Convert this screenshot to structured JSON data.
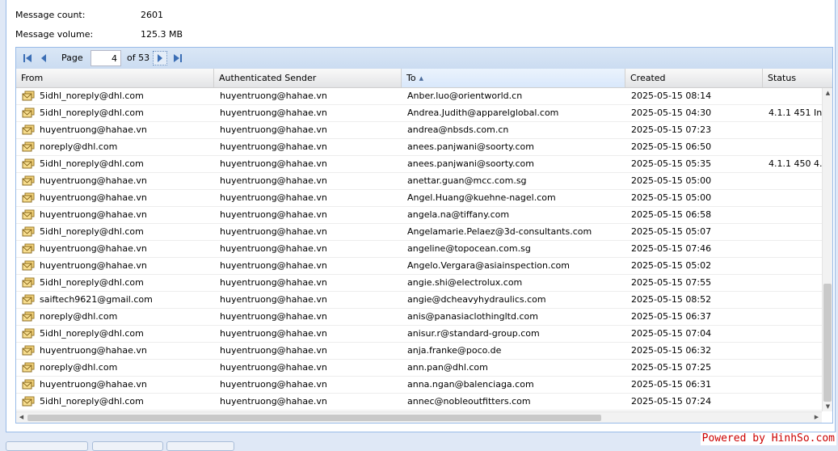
{
  "stats": {
    "message_count_label": "Message count:",
    "message_count_value": "2601",
    "message_volume_label": "Message volume:",
    "message_volume_value": "125.3 MB"
  },
  "pager": {
    "page_label": "Page",
    "current_page": "4",
    "of_total": "of 53",
    "buttons": [
      "first-page-icon",
      "previous-page-icon",
      "next-page-icon",
      "last-page-icon"
    ]
  },
  "columns": {
    "from": "From",
    "auth_sender": "Authenticated Sender",
    "to": "To",
    "created": "Created",
    "status": "Status",
    "sorted_column": "To",
    "sort_direction": "ascending"
  },
  "rows": [
    {
      "from": "5idhl_noreply@dhl.com",
      "auth": "huyentruong@hahae.vn",
      "to": "Anber.luo@orientworld.cn",
      "created": "2025-05-15 08:14",
      "status": ""
    },
    {
      "from": "5idhl_noreply@dhl.com",
      "auth": "huyentruong@hahae.vn",
      "to": "Andrea.Judith@apparelglobal.com",
      "created": "2025-05-15 04:30",
      "status": "4.1.1 451 In"
    },
    {
      "from": "huyentruong@hahae.vn",
      "auth": "huyentruong@hahae.vn",
      "to": "andrea@nbsds.com.cn",
      "created": "2025-05-15 07:23",
      "status": ""
    },
    {
      "from": "noreply@dhl.com",
      "auth": "huyentruong@hahae.vn",
      "to": "anees.panjwani@soorty.com",
      "created": "2025-05-15 06:50",
      "status": ""
    },
    {
      "from": "5idhl_noreply@dhl.com",
      "auth": "huyentruong@hahae.vn",
      "to": "anees.panjwani@soorty.com",
      "created": "2025-05-15 05:35",
      "status": "4.1.1 450 4."
    },
    {
      "from": "huyentruong@hahae.vn",
      "auth": "huyentruong@hahae.vn",
      "to": "anettar.guan@mcc.com.sg",
      "created": "2025-05-15 05:00",
      "status": ""
    },
    {
      "from": "huyentruong@hahae.vn",
      "auth": "huyentruong@hahae.vn",
      "to": "Angel.Huang@kuehne-nagel.com",
      "created": "2025-05-15 05:00",
      "status": ""
    },
    {
      "from": "huyentruong@hahae.vn",
      "auth": "huyentruong@hahae.vn",
      "to": "angela.na@tiffany.com",
      "created": "2025-05-15 06:58",
      "status": ""
    },
    {
      "from": "5idhl_noreply@dhl.com",
      "auth": "huyentruong@hahae.vn",
      "to": "Angelamarie.Pelaez@3d-consultants.com",
      "created": "2025-05-15 05:07",
      "status": ""
    },
    {
      "from": "huyentruong@hahae.vn",
      "auth": "huyentruong@hahae.vn",
      "to": "angeline@topocean.com.sg",
      "created": "2025-05-15 07:46",
      "status": ""
    },
    {
      "from": "huyentruong@hahae.vn",
      "auth": "huyentruong@hahae.vn",
      "to": "Angelo.Vergara@asiainspection.com",
      "created": "2025-05-15 05:02",
      "status": ""
    },
    {
      "from": "5idhl_noreply@dhl.com",
      "auth": "huyentruong@hahae.vn",
      "to": "angie.shi@electrolux.com",
      "created": "2025-05-15 07:55",
      "status": ""
    },
    {
      "from": "saiftech9621@gmail.com",
      "auth": "huyentruong@hahae.vn",
      "to": "angie@dcheavyhydraulics.com",
      "created": "2025-05-15 08:52",
      "status": ""
    },
    {
      "from": "noreply@dhl.com",
      "auth": "huyentruong@hahae.vn",
      "to": "anis@panasiaclothingltd.com",
      "created": "2025-05-15 06:37",
      "status": ""
    },
    {
      "from": "5idhl_noreply@dhl.com",
      "auth": "huyentruong@hahae.vn",
      "to": "anisur.r@standard-group.com",
      "created": "2025-05-15 07:04",
      "status": ""
    },
    {
      "from": "huyentruong@hahae.vn",
      "auth": "huyentruong@hahae.vn",
      "to": "anja.franke@poco.de",
      "created": "2025-05-15 06:32",
      "status": ""
    },
    {
      "from": "noreply@dhl.com",
      "auth": "huyentruong@hahae.vn",
      "to": "ann.pan@dhl.com",
      "created": "2025-05-15 07:25",
      "status": ""
    },
    {
      "from": "huyentruong@hahae.vn",
      "auth": "huyentruong@hahae.vn",
      "to": "anna.ngan@balenciaga.com",
      "created": "2025-05-15 06:31",
      "status": ""
    },
    {
      "from": "5idhl_noreply@dhl.com",
      "auth": "huyentruong@hahae.vn",
      "to": "annec@nobleoutfitters.com",
      "created": "2025-05-15 07:24",
      "status": ""
    }
  ],
  "row_icon": "envelope-stack-icon",
  "watermark": "Powered by HinhSo.com"
}
